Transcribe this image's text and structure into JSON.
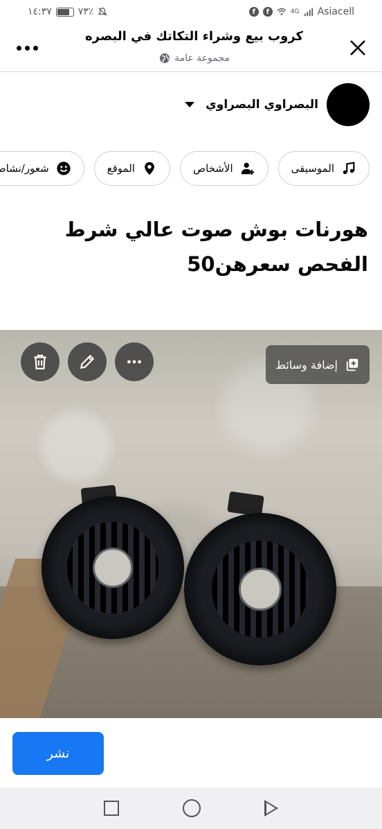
{
  "status_bar": {
    "time": "١٤:٣٧",
    "battery": "٧٣٪",
    "carrier": "Asiacell",
    "network": "4G"
  },
  "header": {
    "title": "كروب بيع وشراء التكاتك في البصره",
    "subtitle": "مجموعة عامة",
    "close_icon": "close-icon",
    "more_icon": "more-icon"
  },
  "author": {
    "name": "البصراوي البصراوي"
  },
  "chips": [
    {
      "label": "الموسيقى",
      "icon": "music-icon"
    },
    {
      "label": "الأشخاص",
      "icon": "tag-people-icon"
    },
    {
      "label": "الموقع",
      "icon": "location-icon"
    },
    {
      "label": "شعور/نشاط",
      "icon": "smiley-icon"
    }
  ],
  "post": {
    "text": "هورنات بوش صوت عالي شرط الفحص سعرهن50"
  },
  "image_overlay": {
    "add_media_label": "إضافة وسائط"
  },
  "publish": {
    "label": "نشر"
  },
  "colors": {
    "accent": "#1877f2",
    "text": "#050505",
    "secondary": "#65676b"
  }
}
